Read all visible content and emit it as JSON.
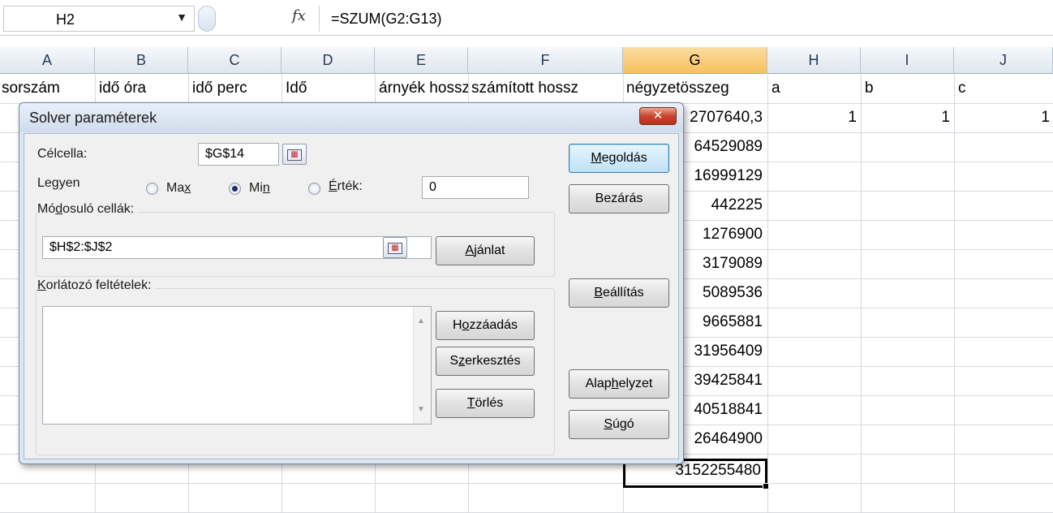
{
  "formula_bar": {
    "name_box": "H2",
    "dropdown_glyph": "▼",
    "fx_label": "fx",
    "formula": "=SZUM(G2:G13)"
  },
  "columns": [
    "A",
    "B",
    "C",
    "D",
    "E",
    "F",
    "G",
    "H",
    "I",
    "J"
  ],
  "active_column": "G",
  "header_row": {
    "A": "sorszám",
    "B": "idő óra",
    "C": "idő perc",
    "D": "Idő",
    "E": "árnyék hossz",
    "F": "számított hossz",
    "G": "négyzetösszeg",
    "H": "a",
    "I": "b",
    "J": "c"
  },
  "row2": {
    "G": "2707640,3",
    "H": "1",
    "I": "1",
    "J": "1"
  },
  "g_values": [
    "64529089",
    "16999129",
    "442225",
    "1276900",
    "3179089",
    "5089536",
    "9665881",
    "31956409",
    "39425841",
    "40518841",
    "26464900"
  ],
  "g_total": "3152255480",
  "dialog": {
    "title": "Solver paraméterek",
    "close_label": "✕",
    "target_label": "Célcella:",
    "target_value": "$G$14",
    "equal_label": "Legyen",
    "max_label": "Max",
    "min_label": "Min",
    "value_label": "Érték:",
    "value_input": "0",
    "changing_label": "Módosuló cellák:",
    "changing_value": "$H$2:$J$2",
    "constraints_label": "Korlátozó feltételek:",
    "selected_option": "min",
    "buttons": {
      "solve": "Megoldás",
      "close": "Bezárás",
      "guess": "Ajánlat",
      "options": "Beállítás",
      "add": "Hozzáadás",
      "change": "Szerkesztés",
      "delete": "Törlés",
      "reset": "Alaphelyzet",
      "help": "Súgó"
    }
  }
}
